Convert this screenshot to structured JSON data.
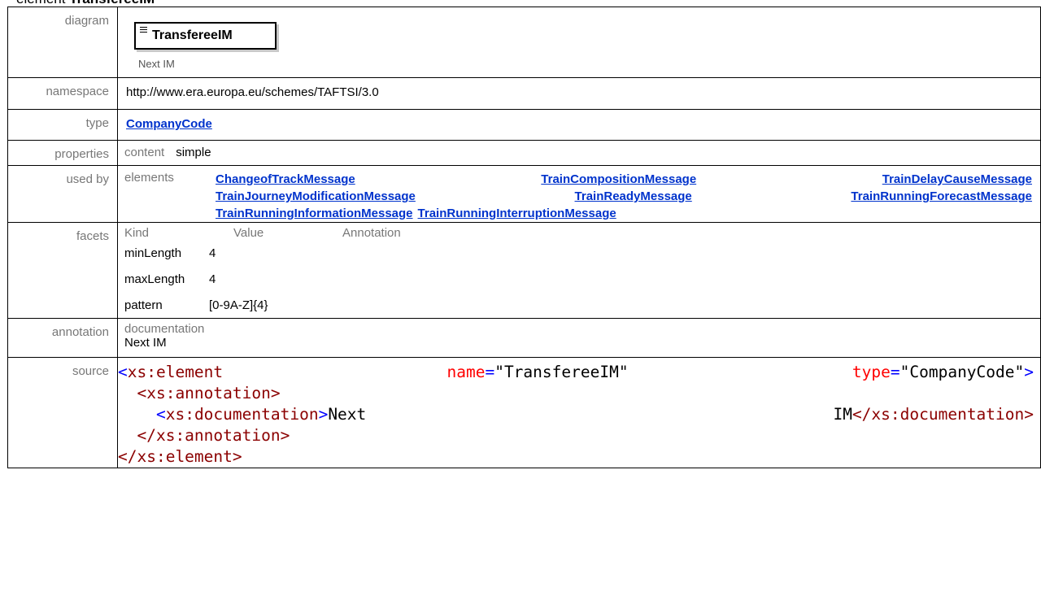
{
  "header": {
    "prefix": "element",
    "name": "TransfereeIM"
  },
  "rows": {
    "diagram": {
      "label": "diagram",
      "element_name": "TransfereeIM",
      "doc": "Next IM"
    },
    "namespace": {
      "label": "namespace",
      "value": "http://www.era.europa.eu/schemes/TAFTSI/3.0"
    },
    "type": {
      "label": "type",
      "value": "CompanyCode"
    },
    "properties": {
      "label": "properties",
      "key": "content",
      "value": "simple"
    },
    "used_by": {
      "label": "used by",
      "key": "elements",
      "links": [
        "ChangeofTrackMessage",
        "TrainCompositionMessage",
        "TrainDelayCauseMessage",
        "TrainJourneyModificationMessage",
        "TrainReadyMessage",
        "TrainRunningForecastMessage",
        "TrainRunningInformationMessage",
        "TrainRunningInterruptionMessage"
      ]
    },
    "facets": {
      "label": "facets",
      "headers": [
        "Kind",
        "Value",
        "Annotation"
      ],
      "items": [
        {
          "kind": "minLength",
          "value": "4"
        },
        {
          "kind": "maxLength",
          "value": "4"
        },
        {
          "kind": "pattern",
          "value": "[0-9A-Z]{4}"
        }
      ]
    },
    "annotation": {
      "label": "annotation",
      "key": "documentation",
      "value": "Next IM"
    },
    "source": {
      "label": "source",
      "line1": {
        "open": "<",
        "tag": "xs:element",
        "attr1": "name",
        "eq": "=",
        "val1": "\"TransfereeIM\"",
        "attr2": "type",
        "val2": "\"CompanyCode\"",
        "close": ">"
      },
      "line2": {
        "text": "<xs:annotation>"
      },
      "line3": {
        "open": "<",
        "tag": "xs:documentation",
        "close": ">",
        "text1": "Next",
        "text2": "IM",
        "end": "</xs:documentation>"
      },
      "line4": {
        "text": "</xs:annotation>"
      },
      "line5": {
        "text": "</xs:element>"
      }
    }
  }
}
